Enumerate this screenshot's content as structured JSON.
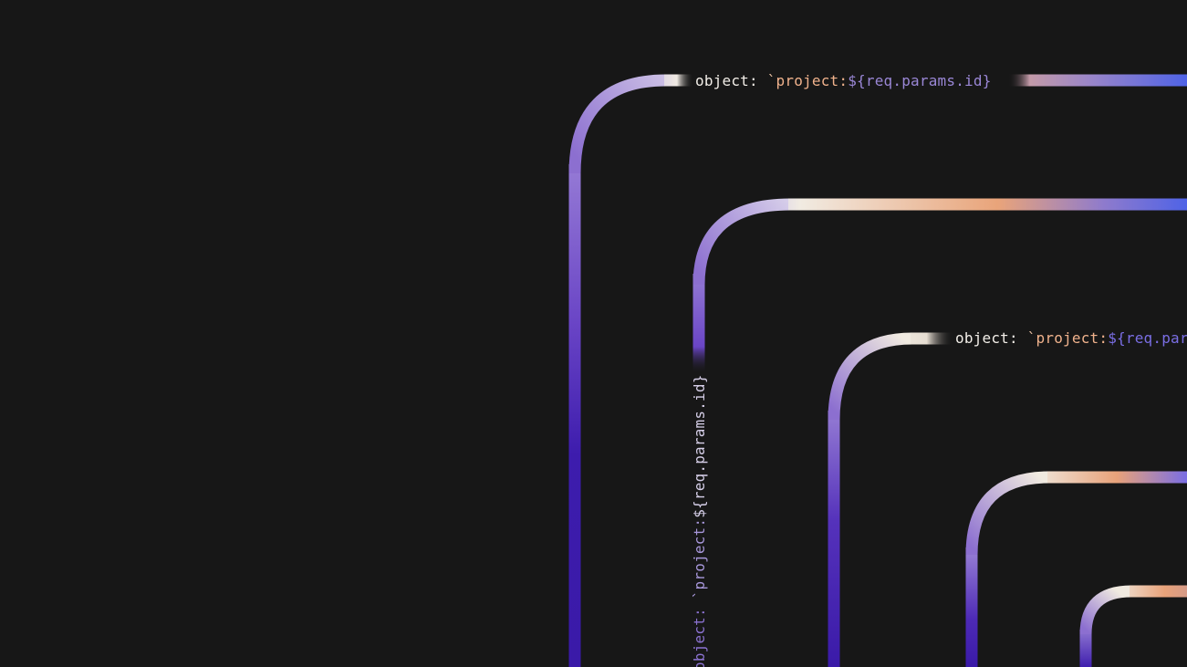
{
  "snippets": {
    "top_key": "object:",
    "top_tick": "`",
    "top_prefix": "project:",
    "top_expr": "${req.params.id}",
    "vertical_key": "object:",
    "vertical_tick": "`",
    "vertical_prefix": "project:",
    "vertical_expr": "${req.params.id}",
    "mid_key": "object:",
    "mid_tick": "`",
    "mid_prefix": "project:",
    "mid_expr": "${req.params.id}"
  },
  "colors": {
    "background": "#171717",
    "white": "#ece6dc",
    "lavender": "#a08bd8",
    "purple": "#6c46c4",
    "indigo": "#3a1aa8",
    "peach": "#e7a57c",
    "blue": "#4f63e6",
    "key_text": "#f2eee8",
    "tick_text": "#e9c0a2",
    "prefix_text": "#f0b28c",
    "expr_text": "#9a87d6",
    "mid_expr_text": "#7a6ee4"
  }
}
